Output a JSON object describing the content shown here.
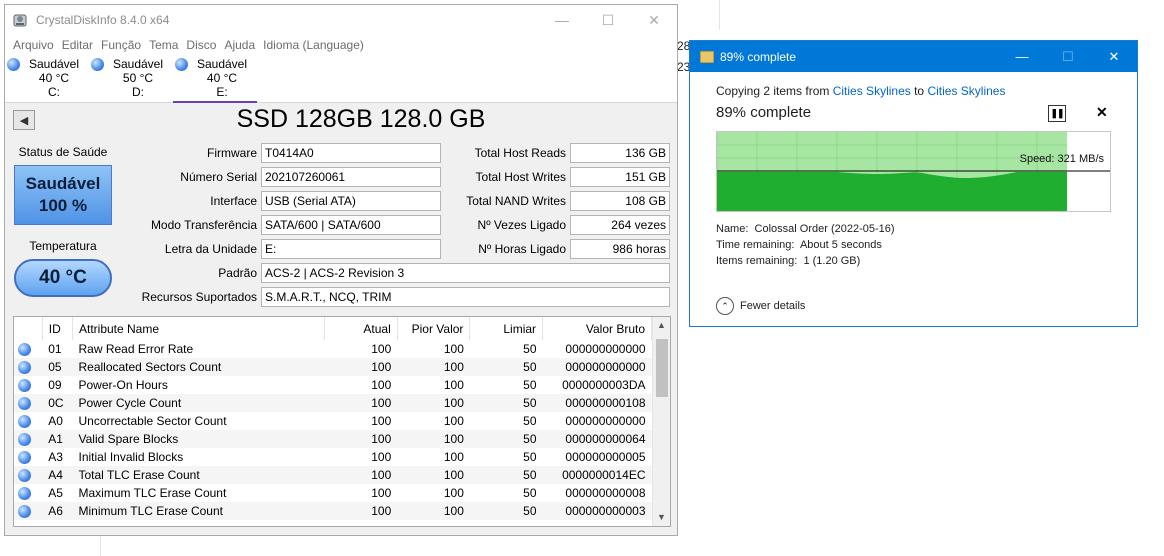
{
  "cdi": {
    "title": "CrystalDiskInfo 8.4.0 x64",
    "menu": [
      "Arquivo",
      "Editar",
      "Função",
      "Tema",
      "Disco",
      "Ajuda",
      "Idioma (Language)"
    ],
    "disks": [
      {
        "status": "Saudável",
        "temp": "40 °C",
        "letter": "C:"
      },
      {
        "status": "Saudável",
        "temp": "50 °C",
        "letter": "D:"
      },
      {
        "status": "Saudável",
        "temp": "40 °C",
        "letter": "E:"
      }
    ],
    "model": "SSD 128GB 128.0 GB",
    "health_label": "Status de Saúde",
    "health_status": "Saudável",
    "health_pct": "100 %",
    "temp_label": "Temperatura",
    "temp_value": "40 °C",
    "fields": {
      "firmware": {
        "label": "Firmware",
        "value": "T0414A0"
      },
      "serial": {
        "label": "Número Serial",
        "value": "202107260061"
      },
      "interface": {
        "label": "Interface",
        "value": "USB (Serial ATA)"
      },
      "transfer": {
        "label": "Modo Transferência",
        "value": "SATA/600 | SATA/600"
      },
      "drive_letter": {
        "label": "Letra da Unidade",
        "value": "E:"
      },
      "standard": {
        "label": "Padrão",
        "value": "ACS-2 | ACS-2 Revision 3"
      },
      "features": {
        "label": "Recursos Suportados",
        "value": "S.M.A.R.T., NCQ, TRIM"
      },
      "host_reads": {
        "label": "Total Host Reads",
        "value": "136 GB"
      },
      "host_writes": {
        "label": "Total Host Writes",
        "value": "151 GB"
      },
      "nand_writes": {
        "label": "Total NAND Writes",
        "value": "108 GB"
      },
      "power_on_count": {
        "label": "Nº Vezes Ligado",
        "value": "264 vezes"
      },
      "power_on_hours": {
        "label": "Nº Horas Ligado",
        "value": "986 horas"
      }
    },
    "table": {
      "headers": [
        "ID",
        "Attribute Name",
        "Atual",
        "Pior Valor",
        "Limiar",
        "Valor Bruto"
      ],
      "rows": [
        [
          "01",
          "Raw Read Error Rate",
          "100",
          "100",
          "50",
          "000000000000"
        ],
        [
          "05",
          "Reallocated Sectors Count",
          "100",
          "100",
          "50",
          "000000000000"
        ],
        [
          "09",
          "Power-On Hours",
          "100",
          "100",
          "50",
          "0000000003DA"
        ],
        [
          "0C",
          "Power Cycle Count",
          "100",
          "100",
          "50",
          "000000000108"
        ],
        [
          "A0",
          "Uncorrectable Sector Count",
          "100",
          "100",
          "50",
          "000000000000"
        ],
        [
          "A1",
          "Valid Spare Blocks",
          "100",
          "100",
          "50",
          "000000000064"
        ],
        [
          "A3",
          "Initial Invalid Blocks",
          "100",
          "100",
          "50",
          "000000000005"
        ],
        [
          "A4",
          "Total TLC Erase Count",
          "100",
          "100",
          "50",
          "0000000014EC"
        ],
        [
          "A5",
          "Maximum TLC Erase Count",
          "100",
          "100",
          "50",
          "000000000008"
        ],
        [
          "A6",
          "Minimum TLC Erase Count",
          "100",
          "100",
          "50",
          "000000000003"
        ]
      ]
    }
  },
  "copy": {
    "title": "89% complete",
    "from_prefix": "Copying 2 items from ",
    "from_link": "Cities Skylines",
    "to_word": " to ",
    "to_link": "Cities Skylines",
    "pct_text": "89% complete",
    "progress": 0.89,
    "speed": "Speed: 321 MB/s",
    "name_label": "Name:",
    "name_value": "Colossal Order (2022-05-16)",
    "time_label": "Time remaining:",
    "time_value": "About 5 seconds",
    "items_label": "Items remaining:",
    "items_value": "1 (1.20 GB)",
    "fewer": "Fewer details"
  },
  "background": {
    "frag1": "28",
    "frag2": "23"
  }
}
